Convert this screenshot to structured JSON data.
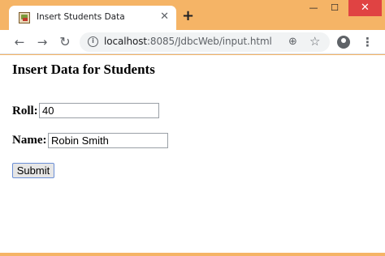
{
  "browser": {
    "tab": {
      "title": "Insert Students Data",
      "close": "✕"
    },
    "new_tab": "+",
    "window_controls": {
      "minimize": "—",
      "maximize": "☐",
      "close": "✕"
    },
    "nav": {
      "back": "←",
      "forward": "→",
      "reload": "↻"
    },
    "omnibox": {
      "url_host": "localhost",
      "url_rest": ":8085/JdbcWeb/input.html",
      "info": "i"
    },
    "icons": {
      "zoom": "⊕",
      "star": "☆",
      "menu": "⋮"
    }
  },
  "page": {
    "title": "Insert Data for Students",
    "form": {
      "roll_label": "Roll:",
      "roll_value": "40",
      "name_label": "Name:",
      "name_value": "Robin Smith",
      "submit_label": "Submit"
    }
  },
  "colors": {
    "frame": "#f5b466",
    "window_close": "#e04343"
  }
}
